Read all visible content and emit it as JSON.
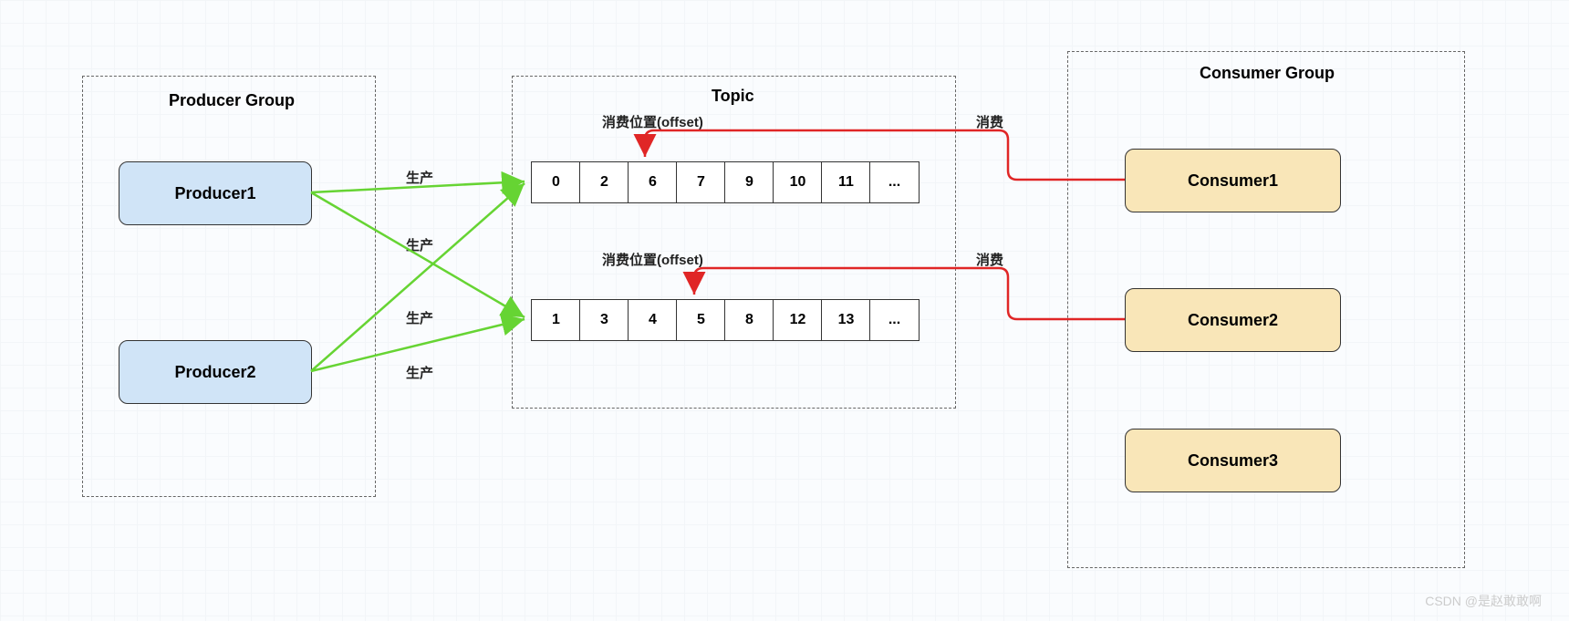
{
  "groups": {
    "producer": {
      "title": "Producer Group"
    },
    "topic": {
      "title": "Topic"
    },
    "consumer": {
      "title": "Consumer Group"
    }
  },
  "producers": [
    {
      "label": "Producer1"
    },
    {
      "label": "Producer2"
    }
  ],
  "consumers": [
    {
      "label": "Consumer1"
    },
    {
      "label": "Consumer2"
    },
    {
      "label": "Consumer3"
    }
  ],
  "queues": [
    {
      "offset_label": "消费位置(offset)",
      "consume_label": "消费",
      "cells": [
        "0",
        "2",
        "6",
        "7",
        "9",
        "10",
        "11",
        "..."
      ],
      "offset_index": 2
    },
    {
      "offset_label": "消费位置(offset)",
      "consume_label": "消费",
      "cells": [
        "1",
        "3",
        "4",
        "5",
        "8",
        "12",
        "13",
        "..."
      ],
      "offset_index": 3
    }
  ],
  "produce_labels": [
    "生产",
    "生产",
    "生产",
    "生产"
  ],
  "watermark": "CSDN @是赵敢敢啊",
  "chart_data": {
    "type": "diagram",
    "title": "Message Queue Topic Architecture (Producer/Topic/Consumer)",
    "nodes": [
      {
        "id": "ProducerGroup",
        "type": "group",
        "label": "Producer Group",
        "children": [
          "Producer1",
          "Producer2"
        ]
      },
      {
        "id": "Producer1",
        "type": "producer",
        "label": "Producer1"
      },
      {
        "id": "Producer2",
        "type": "producer",
        "label": "Producer2"
      },
      {
        "id": "Topic",
        "type": "group",
        "label": "Topic",
        "children": [
          "Queue1",
          "Queue2"
        ]
      },
      {
        "id": "Queue1",
        "type": "queue",
        "cells": [
          "0",
          "2",
          "6",
          "7",
          "9",
          "10",
          "11",
          "..."
        ],
        "consume_offset_index": 2,
        "offset_label": "消费位置(offset)"
      },
      {
        "id": "Queue2",
        "type": "queue",
        "cells": [
          "1",
          "3",
          "4",
          "5",
          "8",
          "12",
          "13",
          "..."
        ],
        "consume_offset_index": 3,
        "offset_label": "消费位置(offset)"
      },
      {
        "id": "ConsumerGroup",
        "type": "group",
        "label": "Consumer Group",
        "children": [
          "Consumer1",
          "Consumer2",
          "Consumer3"
        ]
      },
      {
        "id": "Consumer1",
        "type": "consumer",
        "label": "Consumer1"
      },
      {
        "id": "Consumer2",
        "type": "consumer",
        "label": "Consumer2"
      },
      {
        "id": "Consumer3",
        "type": "consumer",
        "label": "Consumer3"
      }
    ],
    "edges": [
      {
        "from": "Producer1",
        "to": "Queue1",
        "label": "生产",
        "color": "green"
      },
      {
        "from": "Producer1",
        "to": "Queue2",
        "label": "生产",
        "color": "green"
      },
      {
        "from": "Producer2",
        "to": "Queue1",
        "label": "生产",
        "color": "green"
      },
      {
        "from": "Producer2",
        "to": "Queue2",
        "label": "生产",
        "color": "green"
      },
      {
        "from": "Consumer1",
        "to": "Queue1",
        "label": "消费",
        "color": "red",
        "target": "offset"
      },
      {
        "from": "Consumer2",
        "to": "Queue2",
        "label": "消费",
        "color": "red",
        "target": "offset"
      }
    ]
  }
}
